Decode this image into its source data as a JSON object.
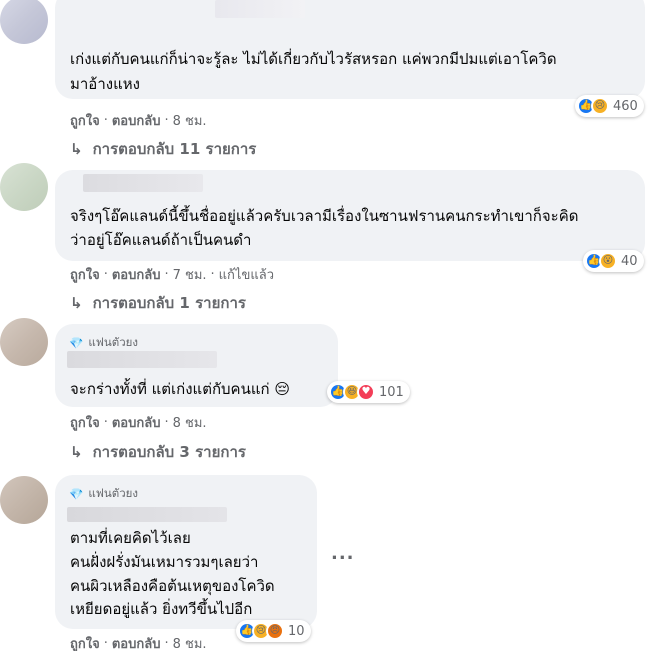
{
  "comments": [
    {
      "lines": [
        "เก่งแต่กับคนแก่ก็น่าจะรู้ละ ไม่ได้เกี่ยวกับไวรัสหรอก แค่พวกมีปมแต่เอาโควิด",
        "มาอ้างแหง"
      ],
      "actions": {
        "like": "ถูกใจ",
        "reply": "ตอบกลับ",
        "time": "8 ชม."
      },
      "reaction_count": "460",
      "reaction_icons": [
        "like-icon",
        "sad-icon"
      ],
      "replies": "การตอบกลับ 11 รายการ"
    },
    {
      "lines": [
        "จริงๆโอ๊คแลนด์นี้ขึ้นชื่ออยู่แล้วครับเวลามีเรื่องในซานฟรานคนกระทำเขาก็จะคิด",
        "ว่าอยู่โอ๊คแลนด์ถ้าเป็นคนดำ"
      ],
      "actions": {
        "like": "ถูกใจ",
        "reply": "ตอบกลับ",
        "time": "7 ชม.",
        "edited": "แก้ไขแล้ว"
      },
      "reaction_count": "40",
      "reaction_icons": [
        "like-icon",
        "wow-icon"
      ],
      "replies": "การตอบกลับ 1 รายการ"
    },
    {
      "badge": "แฟนตัวยง",
      "lines": [
        "จะกร่างทั้งที่ แต่เก่งแต่กับคนแก่ 😔"
      ],
      "actions": {
        "like": "ถูกใจ",
        "reply": "ตอบกลับ",
        "time": "8 ชม."
      },
      "reaction_count": "101",
      "reaction_icons": [
        "like-icon",
        "haha-icon",
        "love-icon"
      ],
      "replies": "การตอบกลับ 3 รายการ"
    },
    {
      "badge": "แฟนตัวยง",
      "lines": [
        "ตามที่เคยคิดไว้เลย",
        "คนฝั่งฝรั่งมันเหมารวมๆเลยว่า",
        "คนผิวเหลืองคือต้นเหตุของโควิด",
        "เหยียดอยู่แล้ว ยิ่งทวีขึ้นไปอีก"
      ],
      "actions": {
        "like": "ถูกใจ",
        "reply": "ตอบกลับ",
        "time": "8 ชม."
      },
      "reaction_count": "10",
      "reaction_icons": [
        "like-icon",
        "sad-icon",
        "angry-icon"
      ],
      "more": "..."
    }
  ],
  "colors": {
    "bubble": "#f0f2f5",
    "meta": "#65676b",
    "like": "#1877f2"
  }
}
